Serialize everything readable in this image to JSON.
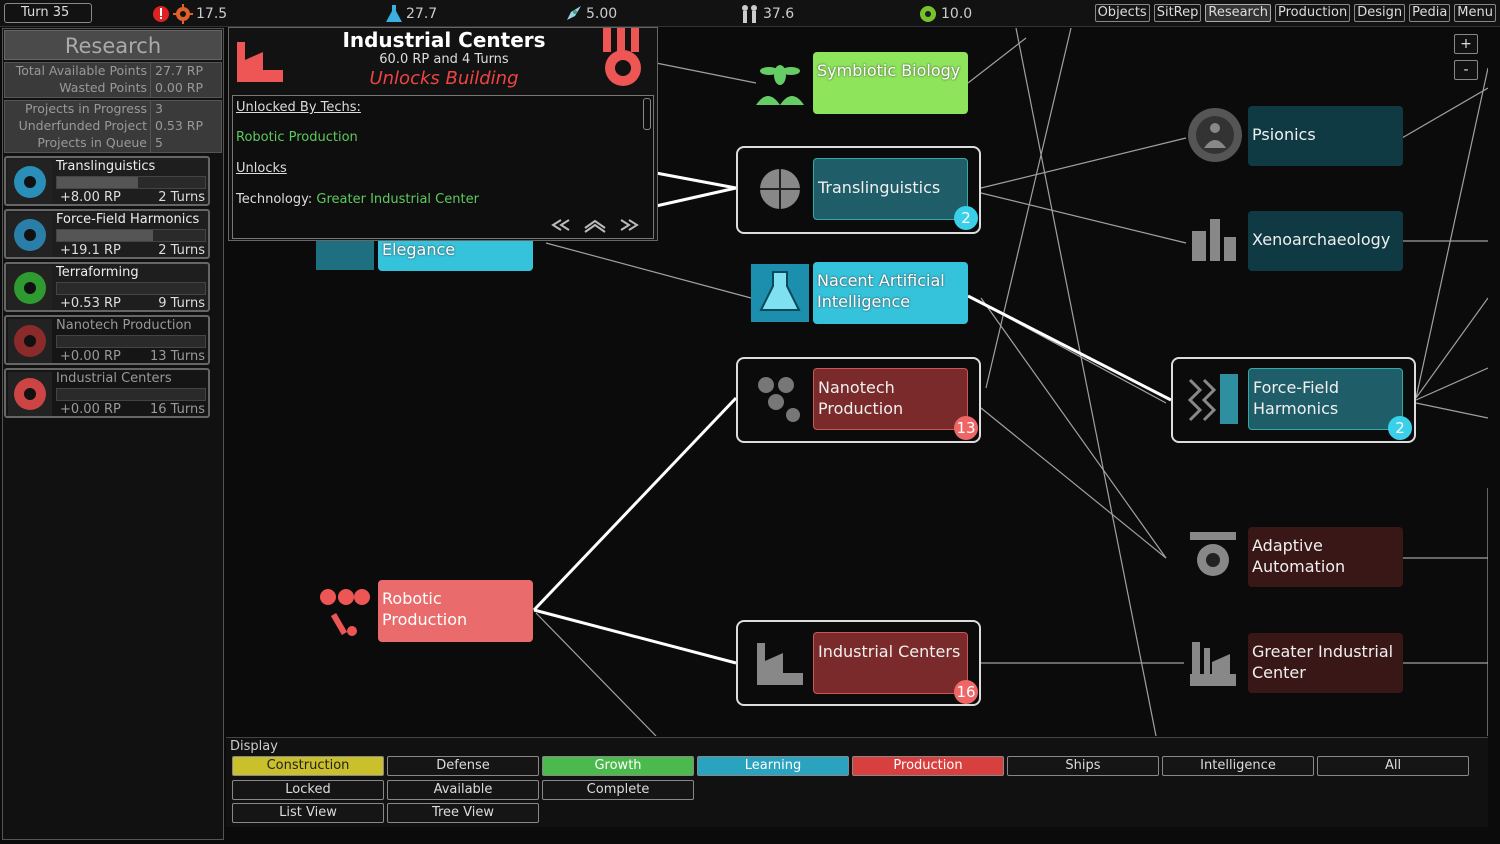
{
  "topbar": {
    "turn": "Turn 35",
    "industry": "17.5",
    "research": "27.7",
    "trade": "5.00",
    "population": "37.6",
    "influence": "10.0",
    "buttons": [
      "Objects",
      "SitRep",
      "Research",
      "Production",
      "Design",
      "Pedia",
      "Menu"
    ],
    "active_button": "Research"
  },
  "research_panel": {
    "title": "Research",
    "stats1": [
      {
        "label": "Total Available Points",
        "value": "27.7 RP"
      },
      {
        "label": "Wasted Points",
        "value": "0.00 RP"
      }
    ],
    "stats2": [
      {
        "label": "Projects in Progress",
        "value": "3"
      },
      {
        "label": "Underfunded Project",
        "value": "0.53 RP"
      },
      {
        "label": "Projects in Queue",
        "value": "5"
      }
    ],
    "queue": [
      {
        "name": "Translinguistics",
        "rp": "+8.00 RP",
        "turns": "2 Turns",
        "progress": 0.55,
        "icon": "translinguistics-icon",
        "color": "#2a8fb8"
      },
      {
        "name": "Force-Field Harmonics",
        "rp": "+19.1 RP",
        "turns": "2 Turns",
        "progress": 0.65,
        "icon": "forcefield-icon",
        "color": "#2a7fa8"
      },
      {
        "name": "Terraforming",
        "rp": "+0.53 RP",
        "turns": "9 Turns",
        "progress": 0.0,
        "icon": "terraforming-icon",
        "color": "#2f9a2f"
      },
      {
        "name": "Nanotech Production",
        "rp": "+0.00 RP",
        "turns": "13 Turns",
        "progress": 0.0,
        "icon": "nanotech-icon",
        "color": "#8a2a2a"
      },
      {
        "name": "Industrial Centers",
        "rp": "+0.00 RP",
        "turns": "16 Turns",
        "progress": 0.0,
        "icon": "factory-icon",
        "color": "#c44"
      }
    ]
  },
  "popup": {
    "title": "Industrial Centers",
    "cost": "60.0 RP and 4 Turns",
    "type": "Unlocks Building",
    "unlocked_by_label": "Unlocked By Techs:",
    "unlocked_by": "Robotic Production",
    "unlocks_label": "Unlocks",
    "unlock_item_prefix": "Technology:",
    "unlock_item": "Greater Industrial Center"
  },
  "tree_nodes": {
    "symbiotic": "Symbiotic Biology",
    "trans": "Translinguistics",
    "trans_badge": "2",
    "elegance": "Elegance",
    "nacent": "Nacent Artificial Intelligence",
    "nanotech": "Nanotech Production",
    "nanotech_badge": "13",
    "robotic": "Robotic Production",
    "industrial": "Industrial Centers",
    "industrial_badge": "16",
    "psionics": "Psionics",
    "xeno": "Xenoarchaeology",
    "forcefield": "Force-Field Harmonics",
    "forcefield_badge": "2",
    "adaptive": "Adaptive Automation",
    "greater": "Greater Industrial Center"
  },
  "display": {
    "label": "Display",
    "categories": [
      "Construction",
      "Defense",
      "Growth",
      "Learning",
      "Production",
      "Ships",
      "Intelligence",
      "All"
    ],
    "status": [
      "Locked",
      "Available",
      "Complete"
    ],
    "views": [
      "List View",
      "Tree View"
    ]
  },
  "zoom": {
    "in": "+",
    "out": "-"
  }
}
